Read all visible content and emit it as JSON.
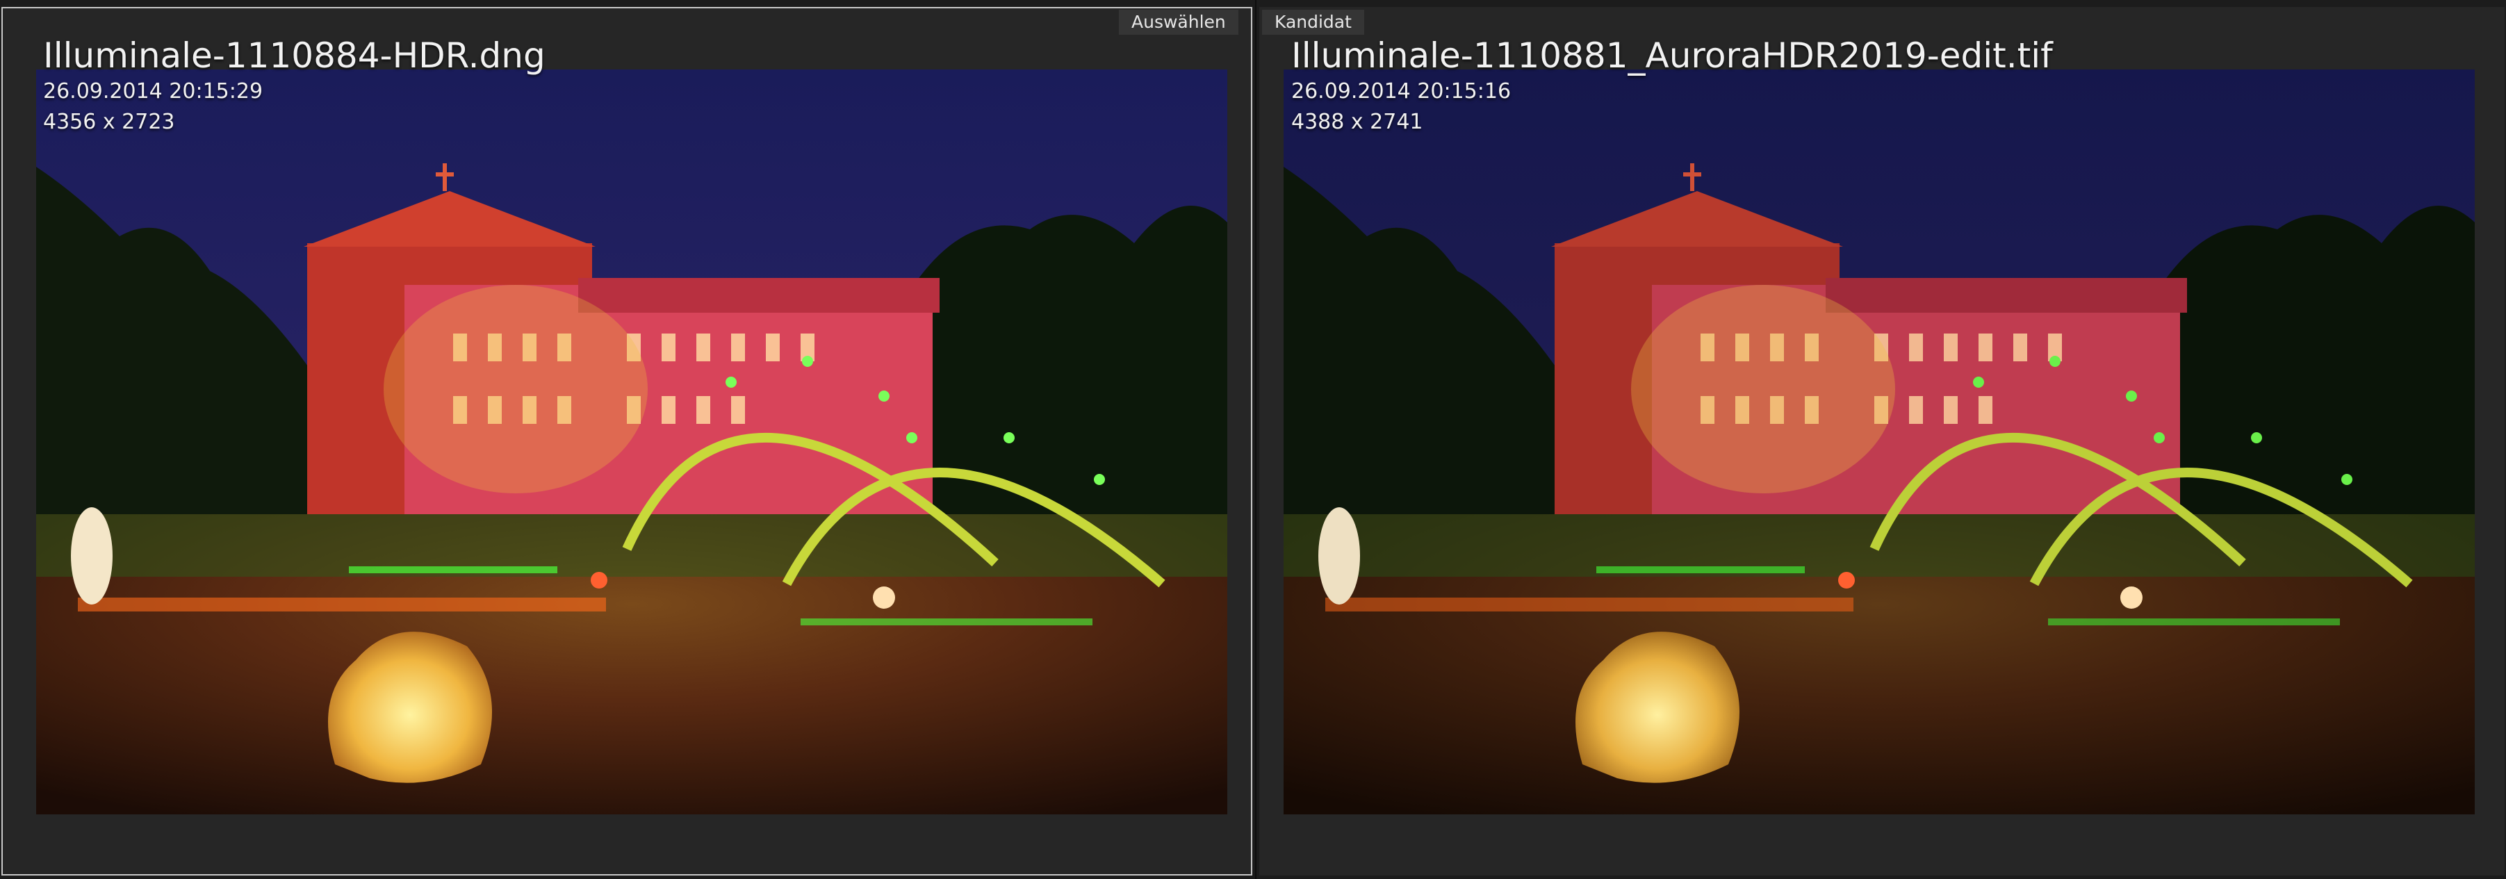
{
  "compare": {
    "select_label": "Auswählen",
    "candidate_label": "Kandidat"
  },
  "left_photo": {
    "filename": "Illuminale-1110884-HDR.dng",
    "datetime": "26.09.2014 20:15:29",
    "dimensions": "4356 x 2723"
  },
  "right_photo": {
    "filename": "Illuminale-1110881_AuroraHDR2019-edit.tif",
    "datetime": "26.09.2014 20:15:16",
    "dimensions": "4388 x 2741"
  },
  "colors": {
    "background": "#1c1c1c",
    "panel": "#262626",
    "selected_border": "#c9c9c9",
    "tag_bg": "#353535",
    "text": "#f2f2f2"
  }
}
